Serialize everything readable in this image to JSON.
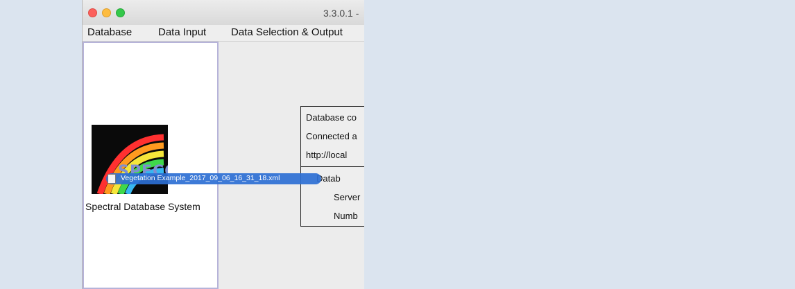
{
  "window": {
    "title": "3.3.0.1 -"
  },
  "menu": [
    "Database",
    "Data Input",
    "Data Selection & Output"
  ],
  "sidebar": {
    "logo_text": "SPECCHIO",
    "caption": "Spectral Database System"
  },
  "connection_info": {
    "status_line": "Database co",
    "connected_line": "Connected a",
    "url_line": "http://local",
    "details": [
      "Datab",
      "Server",
      "Numb"
    ]
  },
  "drag_item": {
    "filename": "Vegetation Example_2017_09_06_16_31_18.xml",
    "icon": "xml-file-icon"
  },
  "colors": {
    "desktop": "#dbe4ef",
    "sidebar_border": "#b6b3d9",
    "drag_highlight": "#2c6fd4"
  }
}
